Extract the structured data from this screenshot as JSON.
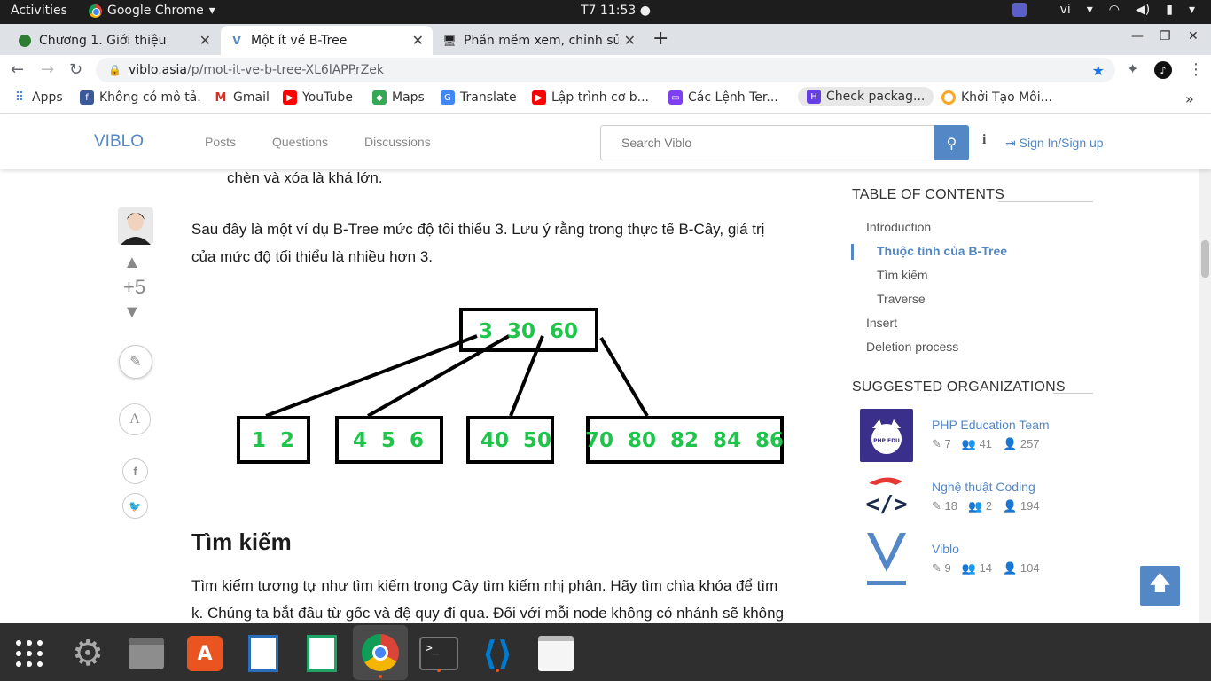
{
  "system": {
    "activities": "Activities",
    "app_name": "Google Chrome",
    "clock": "T7 11:53",
    "lang": "vi"
  },
  "tabs": [
    {
      "title": "Chương 1. Giới thiệu"
    },
    {
      "title": "Một ít về B-Tree"
    },
    {
      "title": "Phần mềm xem, chỉnh sửa"
    }
  ],
  "address": {
    "host": "viblo.asia",
    "path": "/p/mot-it-ve-b-tree-XL6lAPPrZek"
  },
  "bookmarks": [
    {
      "label": "Apps"
    },
    {
      "label": "Không có mô tả."
    },
    {
      "label": "Gmail"
    },
    {
      "label": "YouTube"
    },
    {
      "label": "Maps"
    },
    {
      "label": "Translate"
    },
    {
      "label": "Lập trình cơ b..."
    },
    {
      "label": "Các Lệnh Ter..."
    },
    {
      "label": "Check packag..."
    },
    {
      "label": "Khởi Tạo Môi..."
    }
  ],
  "header": {
    "logo": "VIBLO",
    "nav": [
      "Posts",
      "Questions",
      "Discussions"
    ],
    "search_placeholder": "Search Viblo",
    "signin": "Sign In/Sign up"
  },
  "article": {
    "para0": "chèn và xóa là khá lớn.",
    "para1_line1": "Sau đây là một ví dụ B-Tree mức độ tối thiểu 3. Lưu ý rằng trong thực tế B-Cây, giá trị",
    "para1_line2": "của mức độ tối thiểu là nhiều hơn 3.",
    "heading": "Tìm kiếm",
    "para2_line1": "Tìm kiếm tương tự như tìm kiếm trong Cây tìm kiếm nhị phân. Hãy tìm chìa khóa để tìm",
    "para2_line2": "k. Chúng ta bắt đầu từ gốc và đệ quy đi qua. Đối với mỗi node không có nhánh sẽ không",
    "vote_score": "+5",
    "tree": {
      "root": "3  30  60",
      "leaves": [
        "1  2",
        "4  5  6",
        "40  50",
        "70  80  82  84  86"
      ]
    }
  },
  "toc": {
    "title": "TABLE OF CONTENTS",
    "items": [
      {
        "label": "Introduction"
      },
      {
        "label": "Thuộc tính của B-Tree"
      },
      {
        "label": "Tìm kiếm"
      },
      {
        "label": "Traverse"
      },
      {
        "label": "Insert"
      },
      {
        "label": "Deletion process"
      }
    ]
  },
  "orgs": {
    "title": "SUGGESTED ORGANIZATIONS",
    "list": [
      {
        "name": "PHP Education Team",
        "posts": "7",
        "members": "41",
        "followers": "257"
      },
      {
        "name": "Nghệ thuật Coding",
        "posts": "18",
        "members": "2",
        "followers": "194"
      },
      {
        "name": "Viblo",
        "posts": "9",
        "members": "14",
        "followers": "104"
      }
    ]
  },
  "colors": {
    "accent": "#5387c6",
    "tree_text": "#1fc44a"
  }
}
